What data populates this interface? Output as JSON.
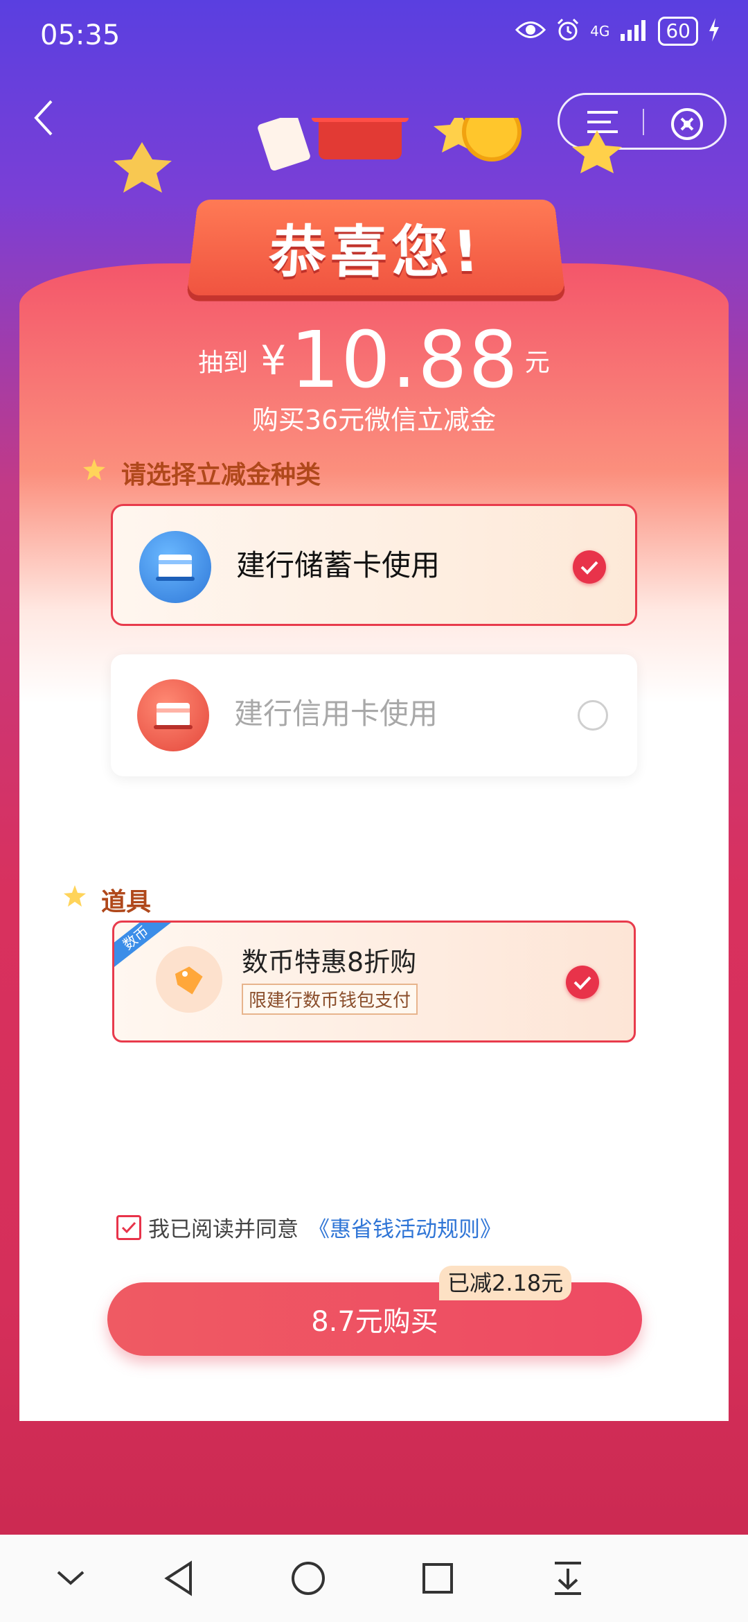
{
  "status_bar": {
    "time": "05:35",
    "network": "4G",
    "battery": "60"
  },
  "header": {
    "congrats": "恭喜您!"
  },
  "prize": {
    "prefix": "抽到",
    "currency": "¥",
    "amount": "10.88",
    "unit": "元",
    "description": "购买36元微信立减金"
  },
  "section_type": {
    "title": "请选择立减金种类",
    "options": [
      {
        "label": "建行储蓄卡使用",
        "selected": true
      },
      {
        "label": "建行信用卡使用",
        "selected": false
      }
    ]
  },
  "section_props": {
    "title": "道具",
    "tag": "数币",
    "item_title": "数币特惠8折购",
    "item_note": "限建行数币钱包支付",
    "selected": true
  },
  "agreement": {
    "text": "我已阅读并同意",
    "link": "《惠省钱活动规则》",
    "checked": true
  },
  "purchase": {
    "button_label": "8.7元购买",
    "discount_badge": "已减2.18元"
  },
  "colors": {
    "accent": "#e8334a",
    "link": "#2f75d6",
    "section_title": "#b0481b"
  },
  "icons": [
    "back-arrow-icon",
    "menu-icon",
    "close-circle-icon",
    "eye-icon",
    "alarm-icon",
    "signal-icon",
    "battery-icon",
    "charging-icon",
    "bank-card-icon",
    "credit-card-icon",
    "tag-icon",
    "check-icon",
    "chevron-down-icon",
    "back-triangle-icon",
    "home-circle-icon",
    "recents-square-icon",
    "download-icon"
  ]
}
